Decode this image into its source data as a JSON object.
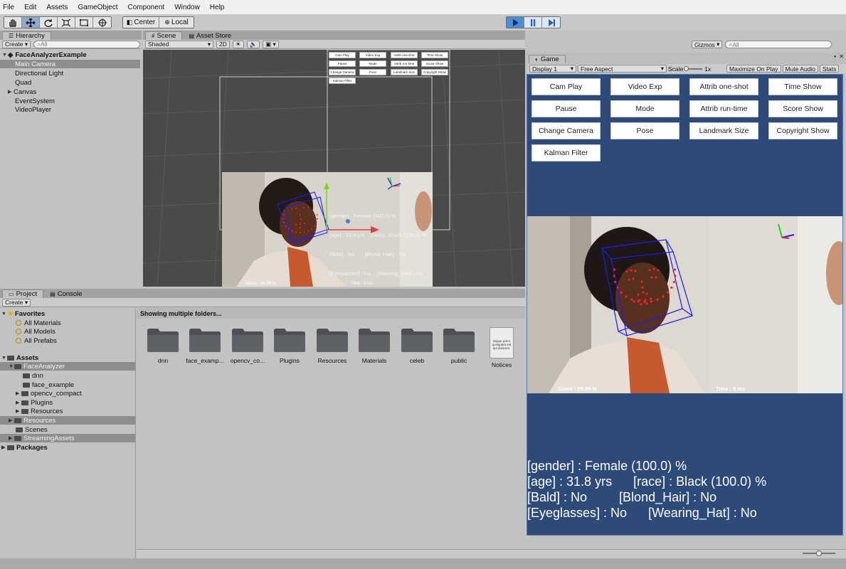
{
  "menu": [
    "File",
    "Edit",
    "Assets",
    "GameObject",
    "Component",
    "Window",
    "Help"
  ],
  "toolbar": {
    "tools": [
      "hand-tool",
      "move-tool",
      "rotate-tool",
      "scale-tool",
      "rect-tool",
      "transform-tool"
    ],
    "pivot": "Center",
    "space": "Local"
  },
  "hierarchy": {
    "tab": "Hierarchy",
    "create": "Create",
    "search_placeholder": "All",
    "scene_name": "FaceAnalyzerExample",
    "items": [
      "Main Camera",
      "Directional Light",
      "Quad",
      "Canvas",
      "EventSystem",
      "VideoPlayer"
    ]
  },
  "scene_view": {
    "tabs": [
      "Scene",
      "Asset Store"
    ],
    "shading": "Shaded",
    "mode_2d": "2D",
    "gizmos": "Gizmos",
    "search_placeholder": "All",
    "mini_buttons": [
      "Cam Play",
      "Video Exp",
      "Attrib one-shot",
      "Time Show",
      "Pause",
      "Mode",
      "Attrib run-time",
      "Score Show",
      "Change Camera",
      "Pose",
      "Landmark Size",
      "Copyright Show",
      "Kalman Filter"
    ],
    "overlay_lines": [
      "[gender] : Female (100.0) %",
      "[age] : 31.8 yrs    [race] : Black (100.0) %",
      "[Bald] : No       [Blond_Hair] : No",
      "[Eyeglasses] : No    [Wearing_Hat] : No"
    ],
    "score": "Score : 99.99 %",
    "time": "Time : 8 ms"
  },
  "project": {
    "tabs": [
      "Project",
      "Console"
    ],
    "create": "Create",
    "favorites_label": "Favorites",
    "favorites": [
      "All Materials",
      "All Models",
      "All Prefabs"
    ],
    "assets_label": "Assets",
    "tree": [
      "FaceAnalyzer",
      "dnn",
      "face_example",
      "opencv_compact",
      "Plugins",
      "Resources",
      "Resources",
      "Scenes",
      "StreamingAssets"
    ],
    "packages_label": "Packages",
    "status": "Showing multiple folders...",
    "folders": [
      "dnn",
      "face_examp...",
      "opencv_co...",
      "Plugins",
      "Resources",
      "Materials",
      "celeb",
      "public",
      "Notices"
    ],
    "notices_preview": "Sogue porro quisquam est qui dolorem."
  },
  "game": {
    "tab": "Game",
    "display": "Display 1",
    "aspect": "Free Aspect",
    "scale_label": "Scale",
    "scale_value": "1x",
    "options": [
      "Maximize On Play",
      "Mute Audio",
      "Stats"
    ],
    "buttons": [
      [
        "Cam Play",
        "Video Exp",
        "Attrib one-shot",
        "Time Show"
      ],
      [
        "Pause",
        "Mode",
        "Attrib run-time",
        "Score Show"
      ],
      [
        "Change Camera",
        "Pose",
        "Landmark Size",
        "Copyright Show"
      ],
      [
        "Kalman Filter"
      ]
    ],
    "score": "Score : 99.99 %",
    "time": "Time : 8 ms",
    "attributes": [
      "[gender] : Female (100.0) %",
      "[age] : 31.8 yrs      [race] : Black (100.0) %",
      "[Bald] : No         [Blond_Hair] : No",
      "[Eyeglasses] : No      [Wearing_Hat] : No"
    ]
  },
  "colors": {
    "game_background": "#2d4a78",
    "play_active": "#4a8fd6",
    "landmark": "#ff2020",
    "face_box": "#1a1aff"
  }
}
